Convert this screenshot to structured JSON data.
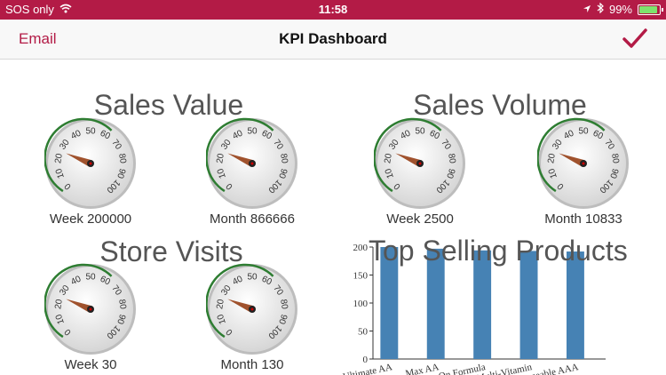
{
  "status": {
    "carrier": "SOS only",
    "time": "11:58",
    "battery": "99%",
    "battery_level": 0.99
  },
  "nav": {
    "left_label": "Email",
    "title": "KPI Dashboard",
    "right_icon": "checkmark-icon",
    "accent": "#b31b46"
  },
  "sections": {
    "sales_value": {
      "title": "Sales Value",
      "week_label": "Week 200000",
      "month_label": "Month 866666"
    },
    "sales_volume": {
      "title": "Sales Volume",
      "week_label": "Week 2500",
      "month_label": "Month 10833"
    },
    "store_visits": {
      "title": "Store Visits",
      "week_label": "Week 30",
      "month_label": "Month 130"
    }
  },
  "gauge_ticks": [
    "0",
    "10",
    "20",
    "30",
    "40",
    "50",
    "60",
    "70",
    "80",
    "90",
    "100"
  ],
  "gauge_reading": 25,
  "colors": {
    "gauge_arc": "#2e7d32",
    "needle": "#a0522d",
    "bar": "#4682b4"
  },
  "chart_data": {
    "type": "bar",
    "title": "Top Selling Products",
    "categories": [
      "Ultimate AA",
      "Max AA",
      "Follow On Formula",
      "Women's Multi-Vitamin",
      "Rechargeable AAA"
    ],
    "values": [
      200,
      197,
      194,
      193,
      192
    ],
    "ylim": [
      0,
      200
    ],
    "yticks": [
      0,
      50,
      100,
      150,
      200
    ]
  }
}
